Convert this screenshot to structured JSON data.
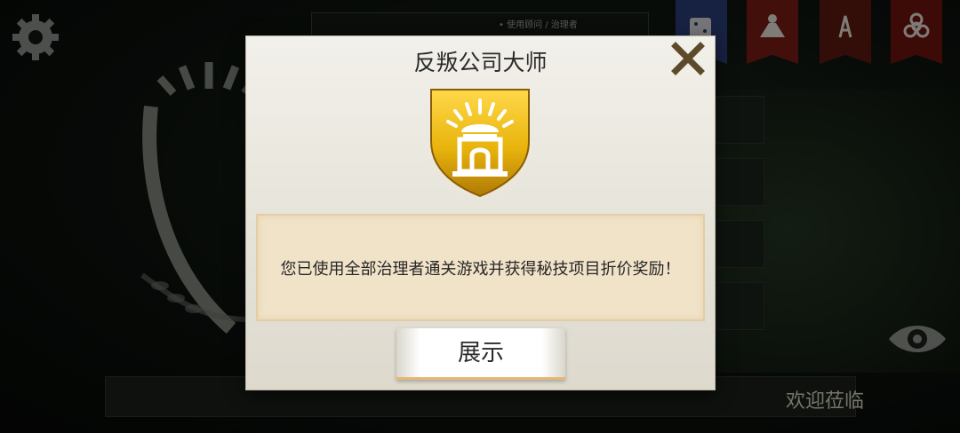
{
  "background": {
    "topbar_text": "• 使用顾问 / 治理者",
    "ticker_text": "欢迎莅临",
    "top_icons": [
      "dice-icon",
      "volcano-icon",
      "oil-rig-icon",
      "biohazard-icon"
    ]
  },
  "dialog": {
    "title": "反叛公司大师",
    "badge_icon": "temple-shield-icon",
    "message": "您已使用全部治理者通关游戏并获得秘技项目折价奖励！",
    "button_label": "展示",
    "close_icon": "close-icon"
  },
  "colors": {
    "dialog_bg": "#ece9e0",
    "message_bg": "#f1e3c8",
    "close_x": "#5d4a2a",
    "badge_gold": "#e8b40c"
  }
}
